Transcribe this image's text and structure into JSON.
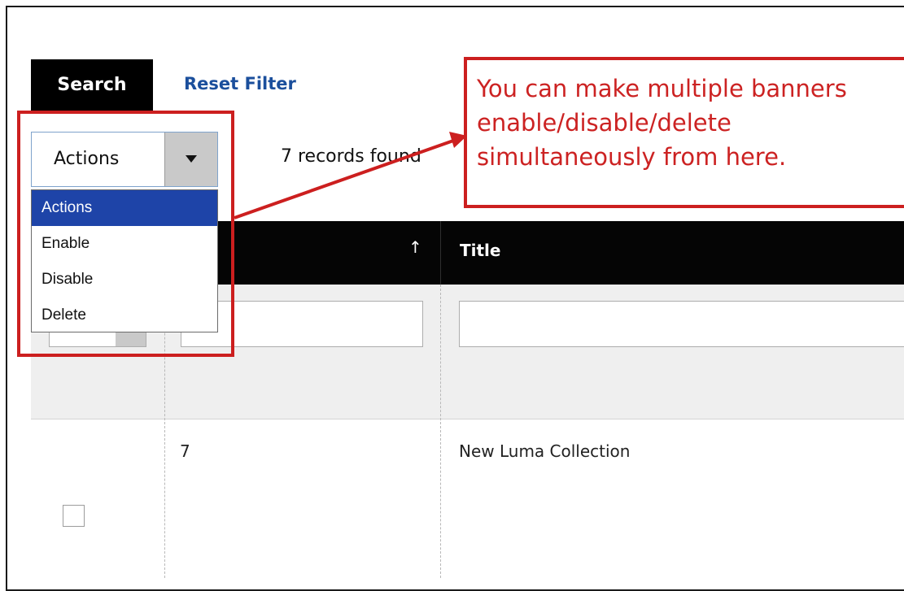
{
  "toolbar": {
    "search_label": "Search",
    "reset_label": "Reset Filter",
    "actions_select_value": "Actions",
    "records_text": "7 records found"
  },
  "actions_dropdown": {
    "options": [
      "Actions",
      "Enable",
      "Disable",
      "Delete"
    ],
    "selected": "Actions"
  },
  "table": {
    "columns": [
      "",
      "Title"
    ],
    "rows": [
      {
        "id": "7",
        "title": "New Luma Collection"
      }
    ]
  },
  "annotation": {
    "text": "You can make multiple banners\nenable/disable/delete\nsimultaneously from here.",
    "color": "#cc1f1f"
  },
  "colors": {
    "selected_option": "#1e44a8",
    "link": "#1b4f9c",
    "header_bg": "#050505"
  }
}
